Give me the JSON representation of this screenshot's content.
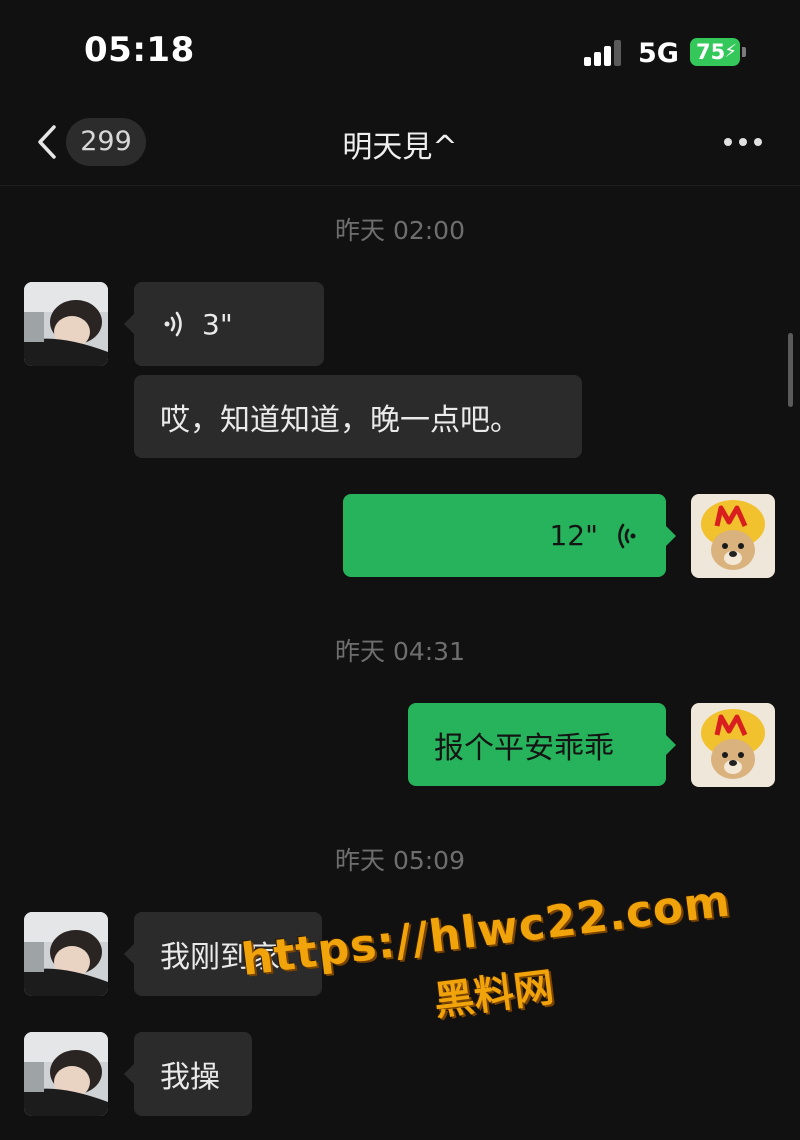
{
  "status_bar": {
    "time": "05:18",
    "network": "5G",
    "battery": "75"
  },
  "nav": {
    "unread_count": "299",
    "title": "明天見^"
  },
  "messages": {
    "sep1": "昨天 02:00",
    "voice_in": "3\"",
    "text_in_1": "哎，知道知道，晚一点吧。",
    "voice_out": "12\"",
    "sep2": "昨天 04:31",
    "text_out_1": "报个平安乖乖",
    "sep3": "昨天 05:09",
    "text_in_2": "我刚到家",
    "text_in_3": "我操"
  },
  "watermark": {
    "url": "https://hlwc22.com",
    "name": "黑料网"
  },
  "colors": {
    "background": "#111111",
    "incoming_bubble": "#2b2b2b",
    "outgoing_bubble": "#26b35c",
    "battery": "#34c759",
    "watermark": "#f0a30a"
  },
  "icons": [
    "back-chevron-icon",
    "more-icon",
    "voice-wave-icon",
    "signal-icon",
    "battery-icon"
  ]
}
